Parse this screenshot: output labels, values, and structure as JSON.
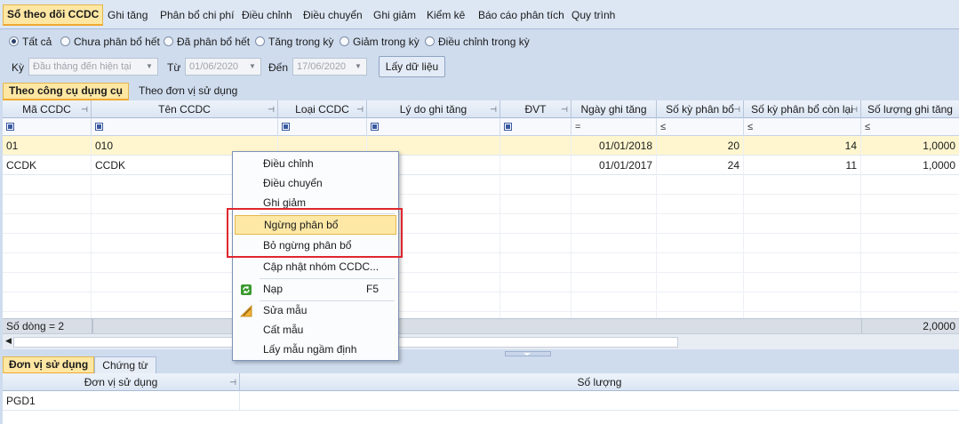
{
  "top_tabs": [
    "Sổ theo dõi CCDC",
    "Ghi tăng",
    "Phân bổ chi phí",
    "Điều chỉnh",
    "Điều chuyển",
    "Ghi giảm",
    "Kiểm kê",
    "Báo cáo phân tích",
    "Quy trình"
  ],
  "filters": {
    "radios": [
      "Tất cả",
      "Chưa phân bổ hết",
      "Đã phân bổ hết",
      "Tăng trong kỳ",
      "Giảm trong kỳ",
      "Điều chỉnh trong kỳ"
    ],
    "selected": "Tất cả",
    "ky_label": "Kỳ",
    "ky_value": "Đầu tháng đến hiện tại",
    "tu_label": "Từ",
    "tu_value": "01/06/2020",
    "den_label": "Đến",
    "den_value": "17/06/2020",
    "fetch_button": "Lấy dữ liệu"
  },
  "grid_tabs": [
    "Theo công cụ dụng cụ",
    "Theo đơn vị sử dụng"
  ],
  "grid": {
    "columns": [
      "Mã CCDC",
      "Tên CCDC",
      "Loại CCDC",
      "Lý do ghi tăng",
      "ĐVT",
      "Ngày ghi tăng",
      "Số kỳ phân bổ",
      "Số kỳ phân bổ còn lại",
      "Số lượng ghi tăng"
    ],
    "filter_ops": [
      "",
      "",
      "",
      "",
      "",
      "=",
      "≤",
      "≤",
      "≤"
    ],
    "rows": [
      [
        "01",
        "010",
        "",
        "",
        "",
        "01/01/2018",
        "20",
        "14",
        "1,0000"
      ],
      [
        "CCDK",
        "CCDK",
        "",
        "",
        "",
        "01/01/2017",
        "24",
        "11",
        "1,0000"
      ]
    ],
    "footer_count": "Số dòng = 2",
    "footer_total": "2,0000"
  },
  "bottom_tabs": [
    "Đơn vị sử dụng",
    "Chứng từ"
  ],
  "bottom_grid": {
    "columns": [
      "Đơn vị sử dụng",
      "Số lượng"
    ],
    "rows": [
      [
        "PGD1",
        ""
      ]
    ]
  },
  "context_menu": {
    "items": [
      {
        "label": "Điều chỉnh",
        "shortcut": "",
        "icon": ""
      },
      {
        "label": "Điều chuyển",
        "shortcut": "",
        "icon": ""
      },
      {
        "label": "Ghi giảm",
        "shortcut": "",
        "icon": ""
      },
      {
        "label": "Ngừng phân bổ",
        "shortcut": "",
        "icon": ""
      },
      {
        "label": "Bỏ ngừng phân bổ",
        "shortcut": "",
        "icon": ""
      },
      {
        "label": "Cập nhật nhóm CCDC...",
        "shortcut": "",
        "icon": ""
      },
      {
        "label": "Nạp",
        "shortcut": "F5",
        "icon": "refresh-icon"
      },
      {
        "label": "Sửa mẫu",
        "shortcut": "",
        "icon": "edit-template-icon"
      },
      {
        "label": "Cất mẫu",
        "shortcut": "",
        "icon": ""
      },
      {
        "label": "Lấy mẫu ngầm định",
        "shortcut": "",
        "icon": ""
      }
    ],
    "highlighted": "Ngừng phân bổ"
  },
  "colors": {
    "active_tab": "#fde7a3",
    "selected_row": "#fff6cf",
    "annotation_box": "#e0262e",
    "refresh_icon": "#3a9a2e"
  }
}
